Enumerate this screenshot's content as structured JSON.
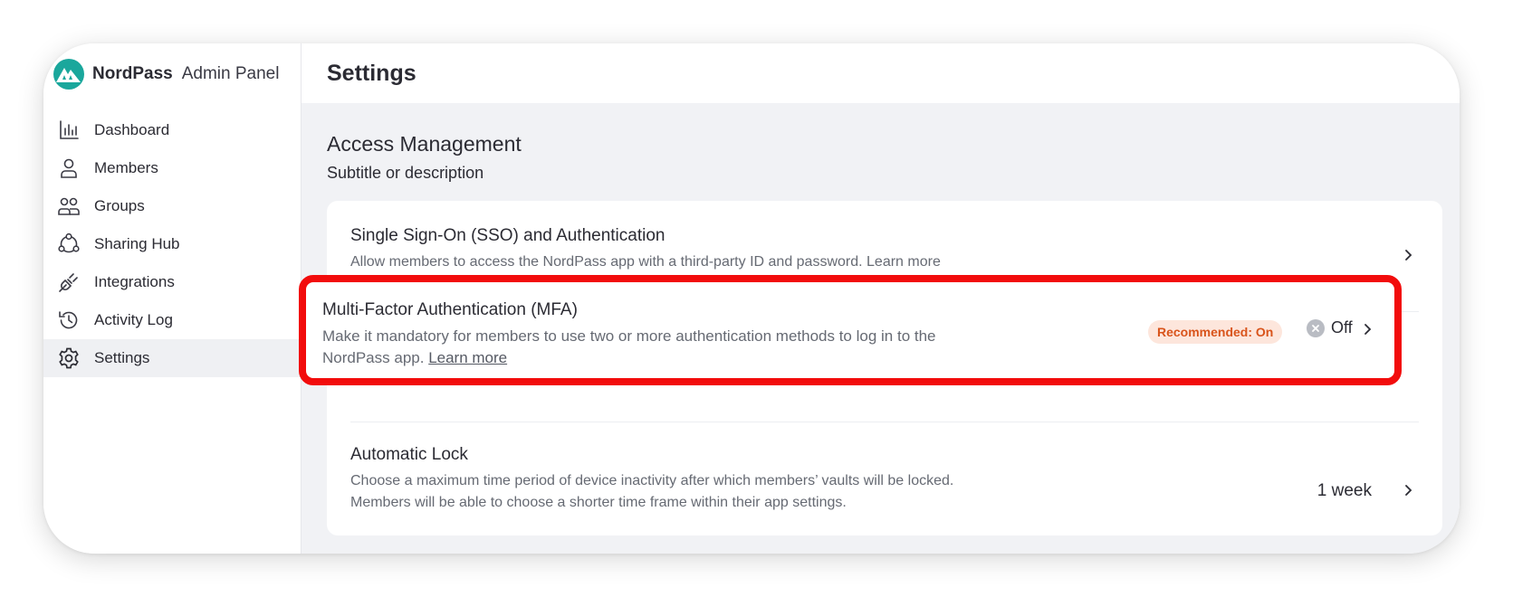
{
  "brand": {
    "name": "NordPass",
    "subtitle": "Admin Panel",
    "logo_icon": "nordpass-logo-icon",
    "accent": "#1aa79c"
  },
  "sidebar": {
    "items": [
      {
        "label": "Dashboard",
        "icon": "chart-icon"
      },
      {
        "label": "Members",
        "icon": "person-icon"
      },
      {
        "label": "Groups",
        "icon": "group-icon"
      },
      {
        "label": "Sharing Hub",
        "icon": "share-icon"
      },
      {
        "label": "Integrations",
        "icon": "plug-icon"
      },
      {
        "label": "Activity Log",
        "icon": "history-icon"
      },
      {
        "label": "Settings",
        "icon": "gear-icon",
        "active": true
      }
    ]
  },
  "header": {
    "title": "Settings"
  },
  "section": {
    "title": "Access Management",
    "subtitle": "Subtitle or description"
  },
  "settings": {
    "sso": {
      "title": "Single Sign-On (SSO) and Authentication",
      "description": "Allow members to access the NordPass app with a third-party ID and password. Learn more"
    },
    "mfa": {
      "title": "Multi-Factor Authentication (MFA)",
      "description_line1": "Make it mandatory for members to use two or more authentication methods to log in to the",
      "description_line2": "NordPass app.",
      "link": "Learn more",
      "badge": "Recommended: On",
      "status": "Off",
      "highlight_color": "#f20c0c"
    },
    "lock": {
      "title": "Automatic Lock",
      "description_line1": "Choose a maximum time period of device inactivity after which members’ vaults will be locked.",
      "description_line2": "Members will be able to choose a shorter time frame within their app settings.",
      "value": "1 week"
    }
  }
}
